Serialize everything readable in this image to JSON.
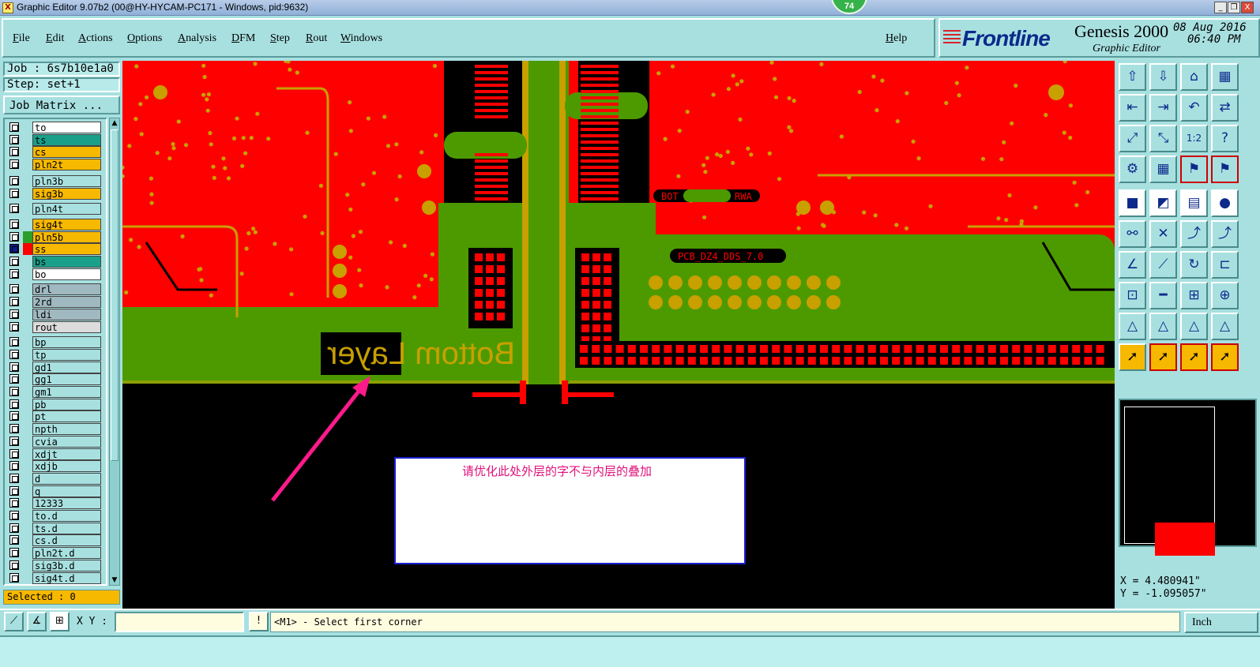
{
  "window": {
    "title": "Graphic Editor 9.07b2 (00@HY-HYCAM-PC171 - Windows, pid:9632)",
    "app_icon_glyph": "X",
    "badge": "74",
    "controls": {
      "minimize": "_",
      "restore": "❐",
      "close": "X"
    }
  },
  "menu": {
    "items": [
      "File",
      "Edit",
      "Actions",
      "Options",
      "Analysis",
      "DFM",
      "Step",
      "Rout",
      "Windows"
    ],
    "help": "Help"
  },
  "brand": {
    "logo": "Frontline",
    "product": "Genesis 2000",
    "subtitle": "Graphic Editor",
    "date": "08 Aug 2016",
    "time": "06:40 PM"
  },
  "job": {
    "job_label": "Job : 6s7b10e1a0",
    "step_label": "Step: set+1",
    "matrix_button": "Job Matrix ..."
  },
  "layers": [
    {
      "name": "to",
      "color": "#ffffff"
    },
    {
      "name": "ts",
      "color": "#1aa08a"
    },
    {
      "name": "cs",
      "color": "#f7b800"
    },
    {
      "name": "pln2t",
      "color": "#f7b800"
    },
    {
      "name": "pln3b",
      "color": "#a8e0e0"
    },
    {
      "name": "sig3b",
      "color": "#f7b800"
    },
    {
      "name": "pln4t",
      "color": "#a8e0e0"
    },
    {
      "name": "sig4t",
      "color": "#f7b800"
    },
    {
      "name": "pln5b",
      "color": "#f7b800",
      "swatch": "#2aa02a"
    },
    {
      "name": "ss",
      "color": "#f7b800",
      "swatch": "#ff0000",
      "active": true
    },
    {
      "name": "bs",
      "color": "#1aa08a"
    },
    {
      "name": "bo",
      "color": "#ffffff"
    },
    {
      "name": "drl",
      "color": "#a0b8c0"
    },
    {
      "name": "2rd",
      "color": "#a0b8c0"
    },
    {
      "name": "ldi",
      "color": "#a0b8c0"
    },
    {
      "name": "rout",
      "color": "#dcdcdc"
    },
    {
      "name": "bp",
      "color": "#a8e0e0"
    },
    {
      "name": "tp",
      "color": "#a8e0e0"
    },
    {
      "name": "gd1",
      "color": "#a8e0e0"
    },
    {
      "name": "gg1",
      "color": "#a8e0e0"
    },
    {
      "name": "gm1",
      "color": "#a8e0e0"
    },
    {
      "name": "pb",
      "color": "#a8e0e0"
    },
    {
      "name": "pt",
      "color": "#a8e0e0"
    },
    {
      "name": "npth",
      "color": "#a8e0e0"
    },
    {
      "name": "cvia",
      "color": "#a8e0e0"
    },
    {
      "name": "xdjt",
      "color": "#a8e0e0"
    },
    {
      "name": "xdjb",
      "color": "#a8e0e0"
    },
    {
      "name": "d",
      "color": "#a8e0e0"
    },
    {
      "name": "q",
      "color": "#a8e0e0"
    },
    {
      "name": "12333",
      "color": "#a8e0e0"
    },
    {
      "name": "to.d",
      "color": "#a8e0e0"
    },
    {
      "name": "ts.d",
      "color": "#a8e0e0"
    },
    {
      "name": "cs.d",
      "color": "#a8e0e0"
    },
    {
      "name": "pln2t.d",
      "color": "#a8e0e0"
    },
    {
      "name": "sig3b.d",
      "color": "#a8e0e0"
    },
    {
      "name": "sig4t.d",
      "color": "#a8e0e0"
    }
  ],
  "selected_label": "Selected : 0",
  "board": {
    "silkscreen_text": "Bottom Layer",
    "label_bot": "BOT",
    "label_rwa": "RWA",
    "label_pcb": "PCB_DZ4_DDS_7.0",
    "annotation": "请优化此处外层的字不与内层的叠加"
  },
  "colors": {
    "copper": "#ff0000",
    "plane": "#4c9a00",
    "pad": "#c8a000",
    "background": "#000000",
    "arrow": "#ff1a8c",
    "annotation_text": "#e0107a"
  },
  "coords": {
    "x": "X = 4.480941\"",
    "y": "Y = -1.095057\""
  },
  "commandline": {
    "xy_label": "X Y :",
    "xy_value": "",
    "prompt": "<M1> - Select first corner",
    "unit": "Inch"
  }
}
